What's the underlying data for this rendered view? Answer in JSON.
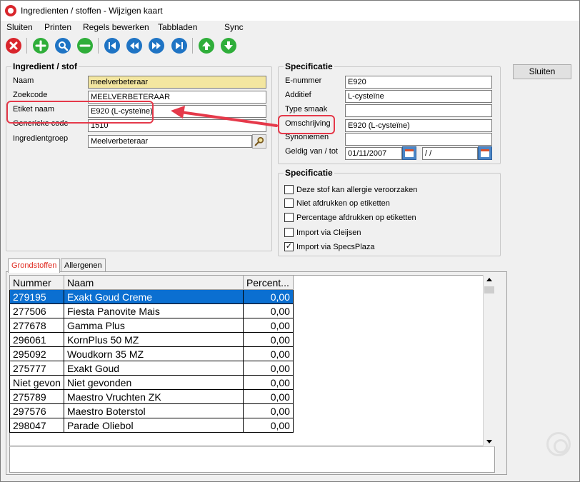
{
  "window": {
    "title": "Ingredienten / stoffen - Wijzigen kaart"
  },
  "menu": [
    {
      "label": "Sluiten"
    },
    {
      "label": "Printen"
    },
    {
      "label": "Regels bewerken"
    },
    {
      "label": "Tabbladen"
    },
    {
      "label": "Sync"
    }
  ],
  "toolbar_icons": [
    "close-icon",
    "add-icon",
    "search-icon",
    "remove-icon",
    "first-icon",
    "previous-icon",
    "next-icon",
    "last-icon",
    "move-up-icon",
    "move-down-icon"
  ],
  "ingredient": {
    "title": "Ingredient / stof",
    "naam_label": "Naam",
    "naam_value": "meelverbeteraar",
    "zoekcode_label": "Zoekcode",
    "zoekcode_value": "MEELVERBETERAAR",
    "etiket_label": "Etiket naam",
    "etiket_value": "E920 (L-cysteïne)",
    "generieke_label": "Generieke code",
    "generieke_value": "1510",
    "groep_label": "Ingredientgroep",
    "groep_value": "Meelverbeteraar"
  },
  "spec": {
    "title": "Specificatie",
    "enummer_label": "E-nummer",
    "enummer_value": "E920",
    "additief_label": "Additief",
    "additief_value": "L-cysteïne",
    "typesmaak_label": "Type smaak",
    "typesmaak_value": "",
    "omschrijving_label": "Omschrijving",
    "omschrijving_value": "E920 (L-cysteïne)",
    "synoniemen_label": "Synoniemen",
    "synoniemen_value": "",
    "geldig_label": "Geldig van / tot",
    "geldig_van": "01/11/2007",
    "geldig_tot": " /  /"
  },
  "spec2": {
    "title": "Specificatie",
    "options": [
      {
        "label": "Deze stof kan allergie veroorzaken",
        "checked": false
      },
      {
        "label": "Niet afdrukken op etiketten",
        "checked": false
      },
      {
        "label": "Percentage afdrukken op etiketten",
        "checked": false
      },
      {
        "label": "Import via Cleijsen",
        "checked": false
      },
      {
        "label": "Import via SpecsPlaza",
        "checked": true
      }
    ]
  },
  "sluiten_button": "Sluiten",
  "tabs": [
    {
      "label": "Grondstoffen"
    },
    {
      "label": "Allergenen"
    }
  ],
  "grid": {
    "headers": [
      "Nummer",
      "Naam",
      "Percent..."
    ],
    "rows": [
      [
        "279195",
        "Exakt Goud Creme",
        "0,00"
      ],
      [
        "277506",
        "Fiesta Panovite Mais",
        "0,00"
      ],
      [
        "277678",
        "Gamma Plus",
        "0,00"
      ],
      [
        "296061",
        "KornPlus 50 MZ",
        "0,00"
      ],
      [
        "295092",
        "Woudkorn 35 MZ",
        "0,00"
      ],
      [
        "275777",
        "Exakt Goud",
        "0,00"
      ],
      [
        "Niet gevon",
        "Niet gevonden",
        "0,00"
      ],
      [
        "275789",
        "Maestro Vruchten ZK",
        "0,00"
      ],
      [
        "297576",
        "Maestro Boterstol",
        "0,00"
      ],
      [
        "298047",
        "Parade Oliebol",
        "0,00"
      ]
    ]
  },
  "colors": {
    "highlight": "#e5394a",
    "selection": "#0b6fd1",
    "naam_field": "#f3e6a0"
  }
}
